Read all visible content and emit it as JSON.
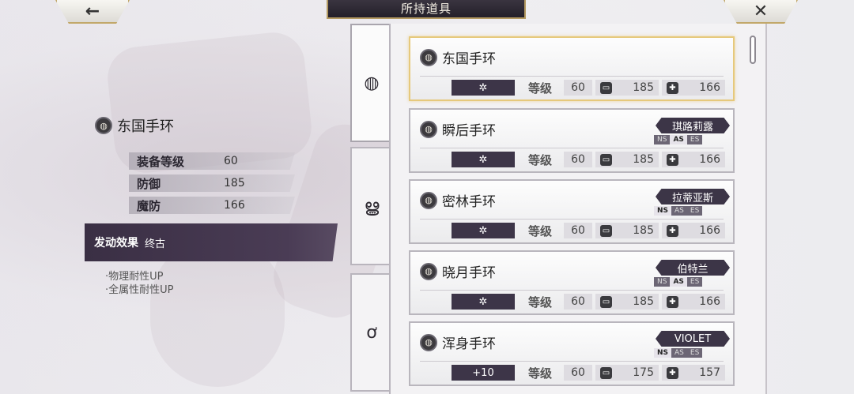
{
  "header": {
    "title": "所持道具",
    "back_icon": "←",
    "close_icon": "✕"
  },
  "detail": {
    "name": "东国手环",
    "stats": [
      {
        "label": "装备等级",
        "value": "60"
      },
      {
        "label": "防御",
        "value": "185"
      },
      {
        "label": "魔防",
        "value": "166"
      }
    ],
    "effect_heading": "发动效果",
    "effect_name": "终古",
    "effect_lines": [
      "·物理耐性UP",
      "·全属性耐性UP"
    ]
  },
  "tabs": [
    {
      "icon": "bracelet-icon",
      "glyph": "◍"
    },
    {
      "icon": "necklace-icon",
      "glyph": "ൠ"
    },
    {
      "icon": "ring-icon",
      "glyph": "ơ"
    }
  ],
  "list_labels": {
    "level": "等级"
  },
  "items": [
    {
      "name": "东国手环",
      "refine": "✲",
      "level": "60",
      "def": "185",
      "mdef": "166",
      "character": "",
      "styles": [],
      "selected": true
    },
    {
      "name": "瞬后手环",
      "refine": "✲",
      "level": "60",
      "def": "185",
      "mdef": "166",
      "character": "琪路莉露",
      "styles": [
        "NS",
        "AS",
        "ES"
      ],
      "active_style": "AS"
    },
    {
      "name": "密林手环",
      "refine": "✲",
      "level": "60",
      "def": "185",
      "mdef": "166",
      "character": "拉蒂亚斯",
      "styles": [
        "NS",
        "AS",
        "ES"
      ],
      "active_style": "NS"
    },
    {
      "name": "晓月手环",
      "refine": "✲",
      "level": "60",
      "def": "185",
      "mdef": "166",
      "character": "伯特兰",
      "styles": [
        "NS",
        "AS",
        "ES"
      ],
      "active_style": "AS"
    },
    {
      "name": "浑身手环",
      "refine": "+10",
      "level": "60",
      "def": "175",
      "mdef": "157",
      "character": "VIOLET",
      "styles": [
        "NS",
        "AS",
        "ES"
      ],
      "active_style": "NS"
    }
  ],
  "colors": {
    "accent_gold": "#c2a86a",
    "dark_purple": "#3c3547"
  }
}
